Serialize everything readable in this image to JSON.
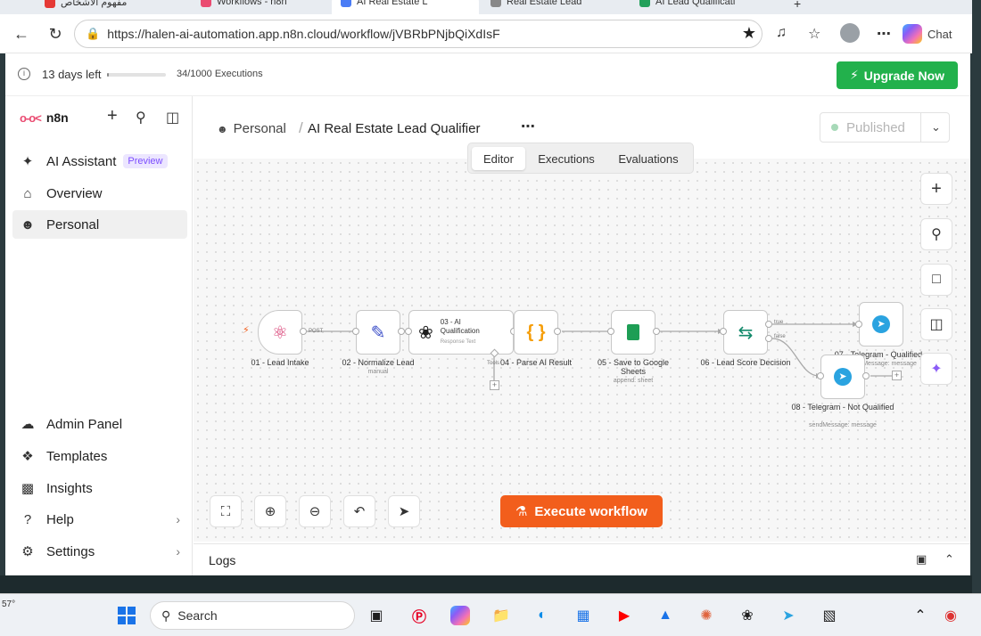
{
  "browser": {
    "tabs": [
      {
        "label": "مفهوم الأشخاص",
        "favicon_color": "#e53935"
      },
      {
        "label": "Workflows - n8n",
        "favicon_color": "#ea4b71"
      },
      {
        "label": "AI Real Estate L",
        "favicon_color": "#4a7cf5"
      },
      {
        "label": "Real Estate Lead",
        "favicon_color": "#888888"
      },
      {
        "label": "AI Lead Qualificati",
        "favicon_color": "#22a05a"
      }
    ],
    "url": "https://halen-ai-automation.app.n8n.cloud/workflow/jVBRbPNjbQiXdIsF",
    "chat_label": "Chat"
  },
  "banner": {
    "days_left": "13 days left",
    "trial_progress": 0.03,
    "executions": "34/1000 Executions",
    "upgrade_label": "Upgrade Now"
  },
  "sidebar": {
    "brand": "n8n",
    "items": [
      {
        "label": "AI Assistant",
        "badge": "Preview"
      },
      {
        "label": "Overview"
      },
      {
        "label": "Personal"
      }
    ],
    "bottom_items": [
      {
        "label": "Admin Panel"
      },
      {
        "label": "Templates"
      },
      {
        "label": "Insights"
      },
      {
        "label": "Help"
      },
      {
        "label": "Settings"
      }
    ]
  },
  "header": {
    "breadcrumb_project": "Personal",
    "workflow_title": "AI Real Estate Lead Qualifier",
    "published_label": "Published"
  },
  "view_tabs": [
    "Editor",
    "Executions",
    "Evaluations"
  ],
  "nodes": [
    {
      "title": "01 - Lead Intake",
      "sub": ""
    },
    {
      "title": "02 - Normalize Lead",
      "sub": "manual"
    },
    {
      "title": "03 - AI Qualification",
      "sub": "Response Text"
    },
    {
      "title": "04 - Parse AI Result",
      "sub": ""
    },
    {
      "title": "05 - Save to Google Sheets",
      "sub": "append: sheet"
    },
    {
      "title": "06 - Lead Score Decision",
      "sub": ""
    },
    {
      "title": "07 - Telegram - Qualified",
      "sub": "sendMessage: message"
    },
    {
      "title": "08 - Telegram - Not Qualified",
      "sub": "sendMessage: message"
    }
  ],
  "edge_labels": {
    "post": "POST",
    "tools": "Tools",
    "true": "true",
    "false": "false"
  },
  "execute_label": "Execute workflow",
  "logs_label": "Logs",
  "taskbar": {
    "search_label": "Search",
    "weather_temp": "57°"
  }
}
